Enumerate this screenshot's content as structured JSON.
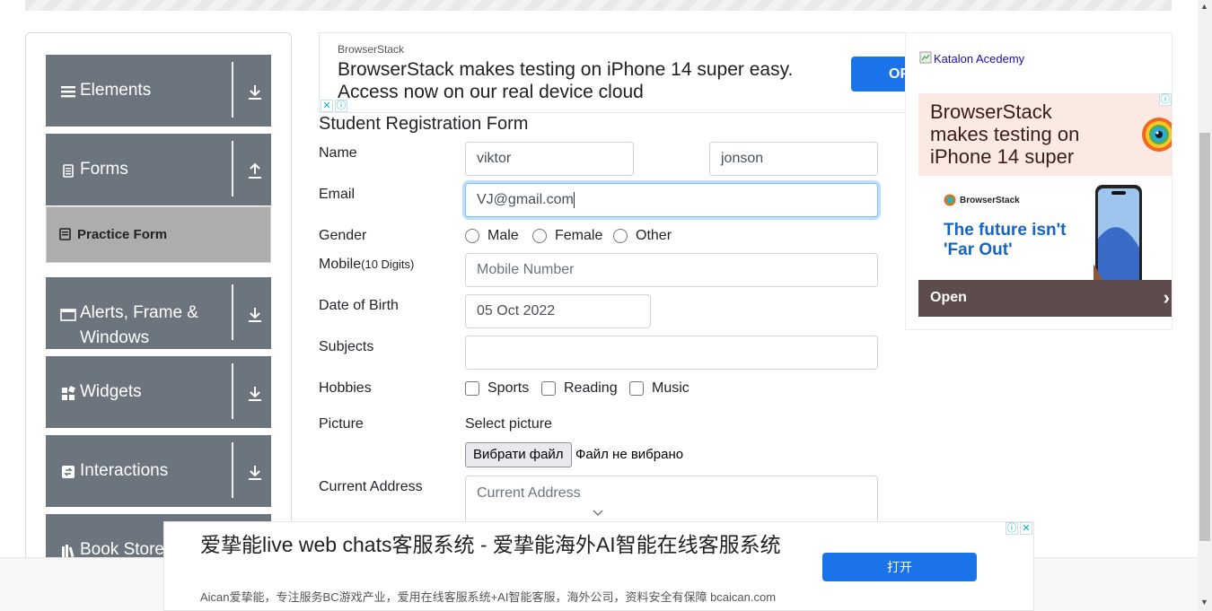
{
  "sidebar": {
    "groups": [
      {
        "label": "Elements",
        "icon": "menu-icon",
        "arrow": "download-icon"
      },
      {
        "label": "Forms",
        "icon": "form-doc-icon",
        "arrow": "upload-icon"
      },
      {
        "label": "Alerts, Frame &",
        "label2": "Windows",
        "icon": "window-icon",
        "arrow": "download-icon"
      },
      {
        "label": "Widgets",
        "icon": "widgets-icon",
        "arrow": "download-icon"
      },
      {
        "label": "Interactions",
        "icon": "interactions-icon",
        "arrow": "download-icon"
      },
      {
        "label": "Book Store",
        "icon": "book-icon",
        "arrow": "download-icon"
      }
    ],
    "active_item": "Practice Form"
  },
  "ad_top": {
    "brand": "BrowserStack",
    "headline": "BrowserStack makes testing on iPhone 14 super easy. Access now on our real device cloud",
    "button": "OP"
  },
  "form": {
    "title": "Student Registration Form",
    "name_label": "Name",
    "first_name": "viktor",
    "last_name": "jonson",
    "email_label": "Email",
    "email": "VJ@gmail.com",
    "gender_label": "Gender",
    "gender_options": [
      "Male",
      "Female",
      "Other"
    ],
    "mobile_label": "Mobile",
    "mobile_hint": "(10 Digits)",
    "mobile_placeholder": "Mobile Number",
    "dob_label": "Date of Birth",
    "dob": "05 Oct 2022",
    "subjects_label": "Subjects",
    "hobbies_label": "Hobbies",
    "hobbies": [
      "Sports",
      "Reading",
      "Music"
    ],
    "picture_label": "Picture",
    "select_picture": "Select picture",
    "file_button": "Вибрати файл",
    "file_status": "Файл не вибрано",
    "address_label": "Current Address",
    "address_placeholder": "Current Address"
  },
  "ad_right": {
    "katalon": "Katalon Acedemy",
    "headline": "BrowserStack makes testing on iPhone 14 super",
    "logo_text": "BrowserStack",
    "tagline": "The future isn't 'Far Out'",
    "open": "Open"
  },
  "ad_bottom": {
    "headline": "爱挚能live web chats客服系统 - 爱挚能海外AI智能在线客服系统",
    "desc": "Aican爱挚能，专注服务BC游戏产业，爱用在线客服系统+AI智能客服，海外公司，资料安全有保障 bcaican.com",
    "button": "打开"
  },
  "colors": {
    "sidebar_group": "#6c757d",
    "active_item": "#adadad",
    "ad_button": "#1a73e8",
    "focus": "#80bdff"
  }
}
